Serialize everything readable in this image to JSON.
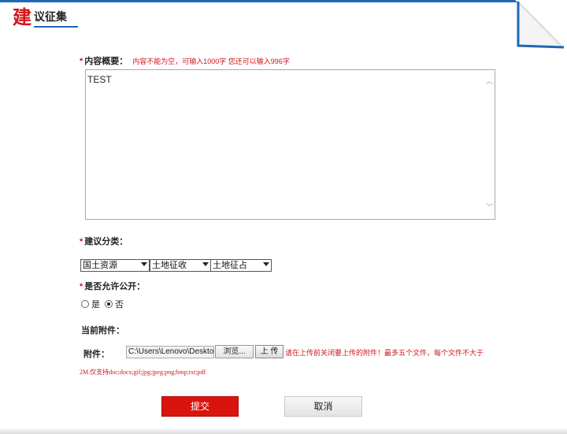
{
  "header": {
    "title_big": "建",
    "title_rest": "议征集"
  },
  "content": {
    "label": "内容概要：",
    "required_mark": "*",
    "hint": "内容不能为空，可输入1000字 您还可以输入996字",
    "value": "TEST"
  },
  "category": {
    "label": "建议分类：",
    "required_mark": "*",
    "selects": [
      "国土资源",
      "土地征收",
      "土地征占"
    ]
  },
  "public": {
    "label": "是否允许公开：",
    "required_mark": "*",
    "options": [
      "是",
      "否"
    ],
    "selected": "否"
  },
  "attachments": {
    "current_label": "当前附件：",
    "label": "附件：",
    "file_path": "C:\\Users\\Lenovo\\Desktop",
    "browse_label": "浏览...",
    "upload_label": "上 传",
    "hint_line1": "请在上传前关闭要上传的附件！最多五个文件，每个文件不大于",
    "hint_line2": "2M.仅支持doc;docx;gif;jpg;jpeg;png;bmp;txt;pdf"
  },
  "actions": {
    "submit_label": "提交",
    "cancel_label": "取消"
  },
  "colors": {
    "accent_red": "#d1161b",
    "frame_blue": "#1f67b4"
  }
}
